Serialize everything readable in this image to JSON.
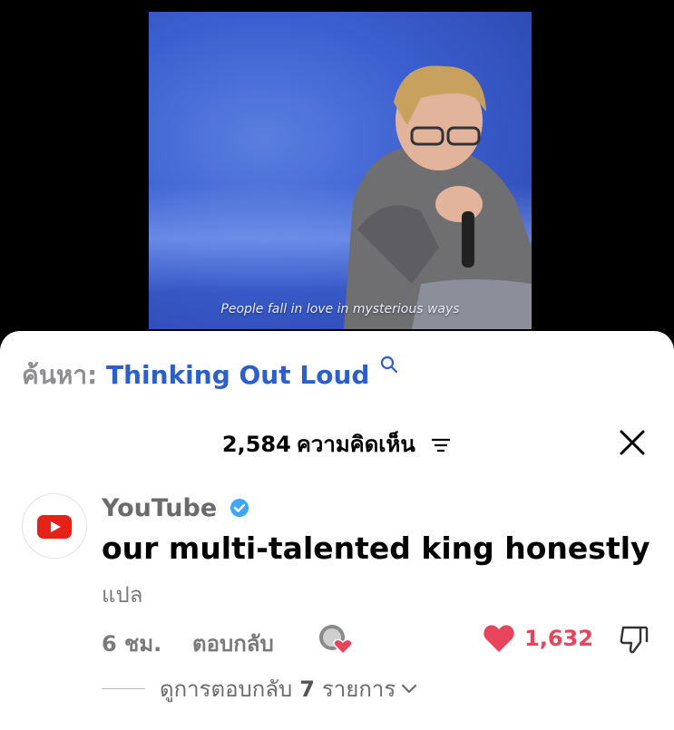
{
  "video": {
    "caption": "People fall in love in mysterious ways"
  },
  "search": {
    "prefix": "ค้นหา:",
    "query": "Thinking Out Loud",
    "icon": "search-icon"
  },
  "comments_header": {
    "count": "2,584",
    "label": "ความคิดเห็น",
    "sort_icon": "sort-icon",
    "close_icon": "close-icon"
  },
  "comment": {
    "author": "YouTube",
    "verified": true,
    "text": "our multi-talented king honestly",
    "translate_label": "แปล",
    "time": "6 ชม.",
    "reply_label": "ตอบกลับ",
    "likes": "1,632",
    "replies": {
      "prefix": "ดูการตอบกลับ",
      "count": "7",
      "suffix": "รายการ"
    }
  },
  "colors": {
    "accent_blue": "#2d5fc9",
    "like_red": "#e8445c",
    "youtube_red": "#e62117",
    "verified_blue": "#3ea6ff"
  }
}
